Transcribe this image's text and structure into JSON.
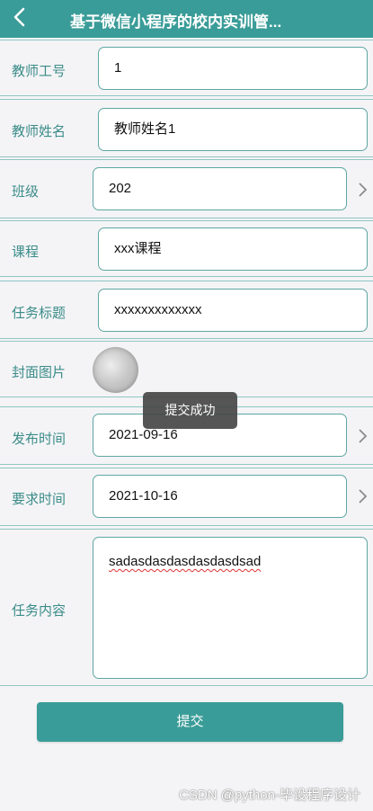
{
  "header": {
    "title": "基于微信小程序的校内实训管...",
    "back_icon": "chevron-left-icon"
  },
  "form": {
    "teacher_id": {
      "label": "教师工号",
      "value": "1"
    },
    "teacher_name": {
      "label": "教师姓名",
      "value": "教师姓名1"
    },
    "class": {
      "label": "班级",
      "value": "202"
    },
    "course": {
      "label": "课程",
      "value": "xxx课程"
    },
    "task_title": {
      "label": "任务标题",
      "value": "xxxxxxxxxxxxx"
    },
    "cover_image": {
      "label": "封面图片"
    },
    "publish_time": {
      "label": "发布时间",
      "value": "2021-09-16"
    },
    "required_time": {
      "label": "要求时间",
      "value": "2021-10-16"
    },
    "task_content": {
      "label": "任务内容",
      "value": "sadasdasdasdasdasdsad"
    }
  },
  "toast": "提交成功",
  "submit_label": "提交",
  "watermark": "CSDN @python-毕设程序设计",
  "colors": {
    "accent": "#3a9c98",
    "label": "#3b8c89",
    "border": "#5ea6a3"
  }
}
